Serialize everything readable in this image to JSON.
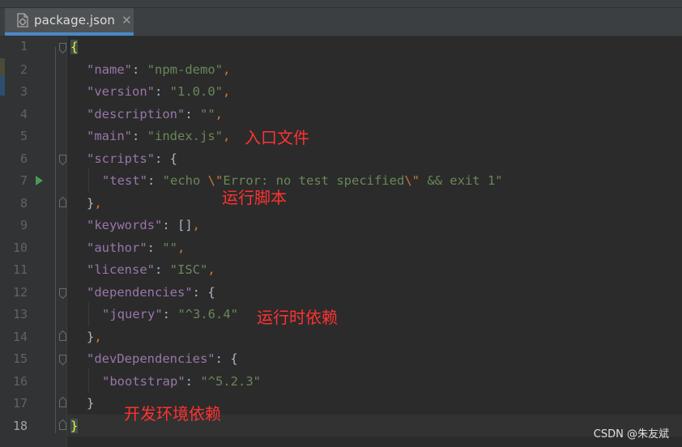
{
  "tab": {
    "filename": "package.json",
    "close_glyph": "✕"
  },
  "gutter": {
    "line_numbers": [
      "1",
      "2",
      "3",
      "4",
      "5",
      "6",
      "7",
      "8",
      "9",
      "10",
      "11",
      "12",
      "13",
      "14",
      "15",
      "16",
      "17",
      "18"
    ],
    "current_line": "18"
  },
  "code": {
    "l1": "{",
    "l2_key": "\"name\"",
    "l2_val": "\"npm-demo\"",
    "l3_key": "\"version\"",
    "l3_val": "\"1.0.0\"",
    "l4_key": "\"description\"",
    "l4_val": "\"\"",
    "l5_key": "\"main\"",
    "l5_val": "\"index.js\"",
    "l6_key": "\"scripts\"",
    "l6_open": "{",
    "l7_key": "\"test\"",
    "l7_val_a": "\"echo ",
    "l7_esc1": "\\\"",
    "l7_val_b": "Error: no test specified",
    "l7_esc2": "\\\"",
    "l7_val_c": " && exit 1\"",
    "l8_close": "}",
    "l9_key": "\"keywords\"",
    "l9_val": "[]",
    "l10_key": "\"author\"",
    "l10_val": "\"\"",
    "l11_key": "\"license\"",
    "l11_val": "\"ISC\"",
    "l12_key": "\"dependencies\"",
    "l12_open": "{",
    "l13_key": "\"jquery\"",
    "l13_val": "\"^3.6.4\"",
    "l14_close": "}",
    "l15_key": "\"devDependencies\"",
    "l15_open": "{",
    "l16_key": "\"bootstrap\"",
    "l16_val": "\"^5.2.3\"",
    "l17_close": "}",
    "l18": "}",
    "colon": ": ",
    "comma": ","
  },
  "annotations": {
    "main_entry": "入口文件",
    "run_script": "运行脚本",
    "runtime_deps": "运行时依赖",
    "dev_deps": "开发环境依赖"
  },
  "watermark": "CSDN @朱友斌",
  "colors": {
    "background": "#2b2b2b",
    "gutter": "#313335",
    "key": "#9876aa",
    "string": "#6a8759",
    "punctuation": "#cc7832",
    "annotation": "#ff3232",
    "tab_accent": "#4a88c7"
  }
}
